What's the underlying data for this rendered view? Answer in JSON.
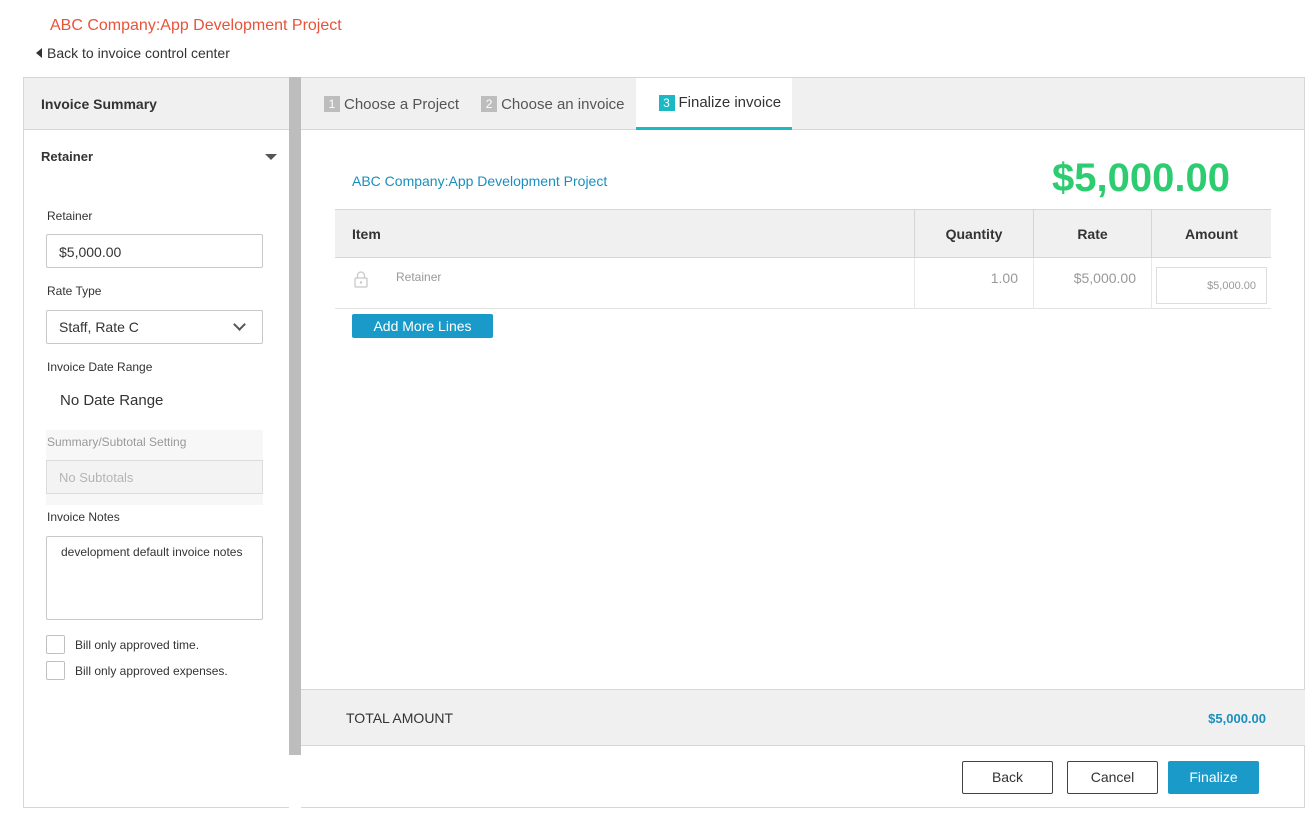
{
  "header": {
    "project_title": "ABC Company:App Development Project",
    "back_link": "Back to invoice control center"
  },
  "sidebar": {
    "title": "Invoice Summary",
    "section": "Retainer",
    "retainer_label": "Retainer",
    "retainer_value": "$5,000.00",
    "rate_type_label": "Rate Type",
    "rate_type_value": "Staff, Rate C",
    "date_range_label": "Invoice Date Range",
    "date_range_value": "No Date Range",
    "subtotal_label": "Summary/Subtotal Setting",
    "subtotal_value": "No Subtotals",
    "notes_label": "Invoice Notes",
    "notes_value": "development default invoice notes",
    "checkbox_time": "Bill only approved time.",
    "checkbox_expenses": "Bill only approved expenses."
  },
  "tabs": [
    {
      "num": "1",
      "label": "Choose a Project"
    },
    {
      "num": "2",
      "label": "Choose an invoice"
    },
    {
      "num": "3",
      "label": "Finalize invoice"
    }
  ],
  "main": {
    "project_link": "ABC Company:App Development Project",
    "total_display": "$5,000.00",
    "table": {
      "headers": [
        "Item",
        "Quantity",
        "Rate",
        "Amount"
      ],
      "rows": [
        {
          "item": "Retainer",
          "quantity": "1.00",
          "rate": "$5,000.00",
          "amount": "$5,000.00"
        }
      ]
    },
    "add_lines_label": "Add More Lines",
    "total_label": "TOTAL AMOUNT",
    "total_value": "$5,000.00"
  },
  "buttons": {
    "back": "Back",
    "cancel": "Cancel",
    "finalize": "Finalize"
  },
  "colors": {
    "accent": "#1a9ac8",
    "total_green": "#2ecc71",
    "title_red": "#e8533a",
    "tab_active": "#1ab9c4"
  }
}
